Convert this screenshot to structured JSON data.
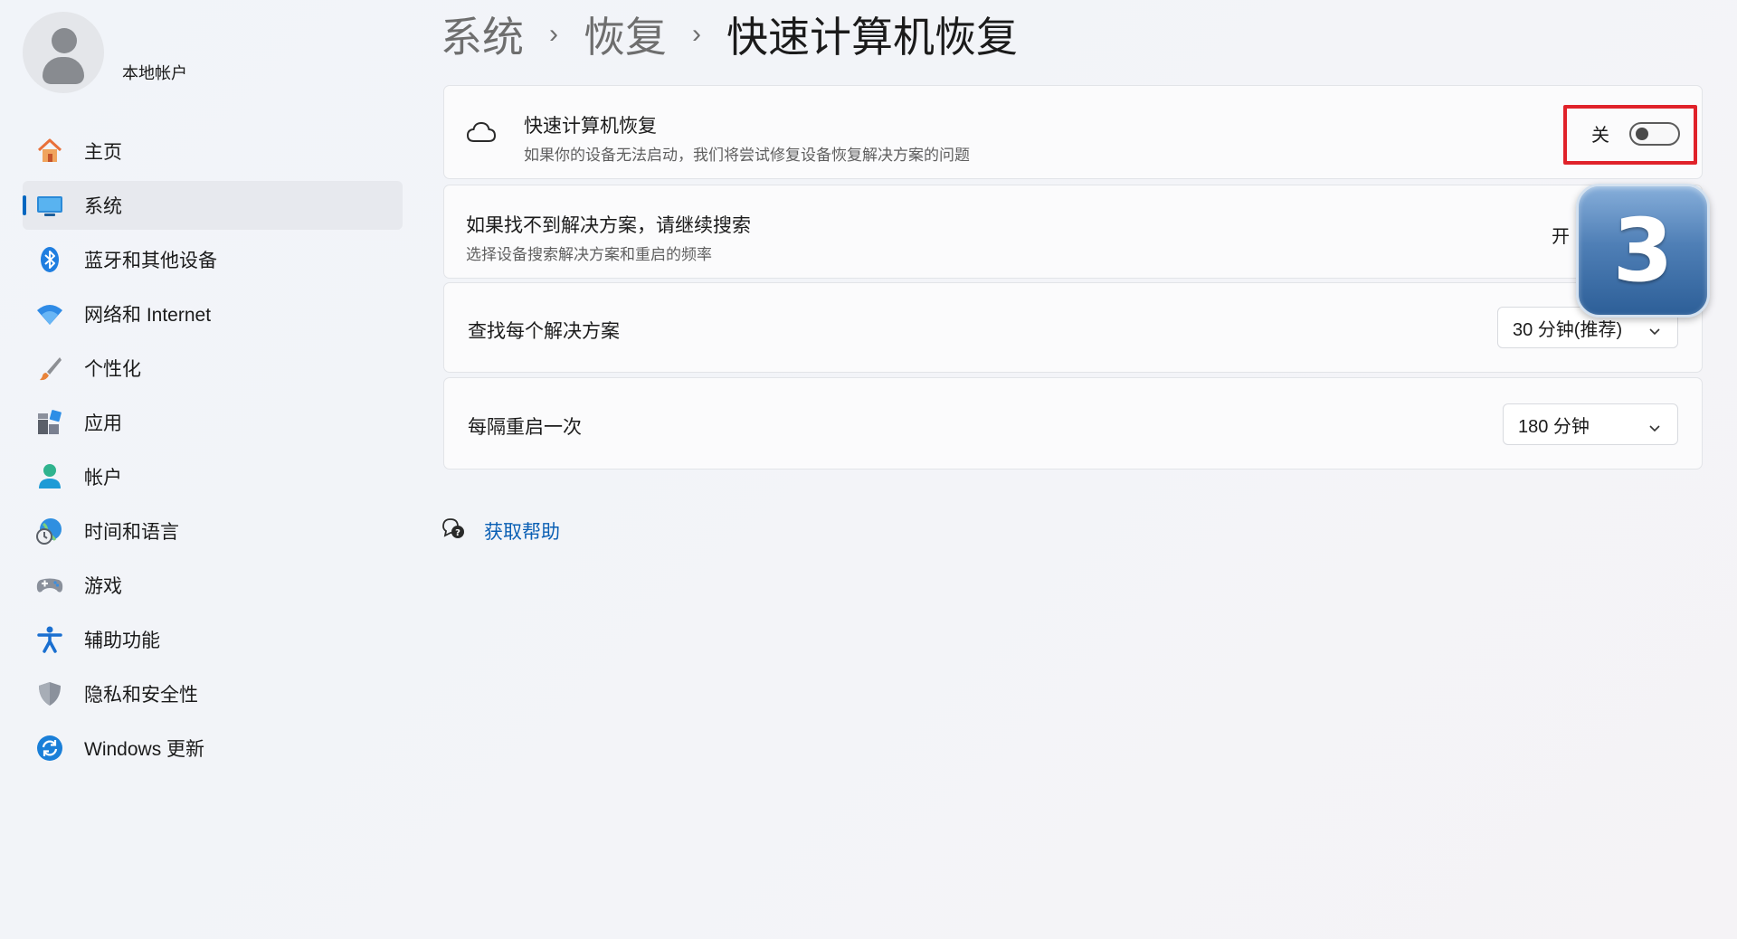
{
  "account": {
    "name": "本地帐户"
  },
  "sidebar": {
    "items": [
      {
        "label": "主页",
        "icon": "home-icon"
      },
      {
        "label": "系统",
        "icon": "monitor-icon",
        "selected": true
      },
      {
        "label": "蓝牙和其他设备",
        "icon": "bluetooth-icon"
      },
      {
        "label": "网络和 Internet",
        "icon": "wifi-icon"
      },
      {
        "label": "个性化",
        "icon": "brush-icon"
      },
      {
        "label": "应用",
        "icon": "apps-icon"
      },
      {
        "label": "帐户",
        "icon": "person-icon"
      },
      {
        "label": "时间和语言",
        "icon": "globe-clock-icon"
      },
      {
        "label": "游戏",
        "icon": "gamepad-icon"
      },
      {
        "label": "辅助功能",
        "icon": "accessibility-icon"
      },
      {
        "label": "隐私和安全性",
        "icon": "shield-icon"
      },
      {
        "label": "Windows 更新",
        "icon": "update-icon"
      }
    ]
  },
  "breadcrumb": {
    "part1": "系统",
    "part2": "恢复",
    "current": "快速计算机恢复",
    "separator": "›"
  },
  "settings": {
    "quick_recovery": {
      "title": "快速计算机恢复",
      "subtitle": "如果你的设备无法启动，我们将尝试修复设备恢复解决方案的问题",
      "state_label": "关",
      "enabled": false,
      "icon": "cloud-icon"
    },
    "continue_search": {
      "title": "如果找不到解决方案，请继续搜索",
      "subtitle": "选择设备搜索解决方案和重启的频率",
      "state_label": "开"
    },
    "search_each": {
      "title": "查找每个解决方案",
      "value": "30 分钟(推荐)"
    },
    "restart_every": {
      "title": "每隔重启一次",
      "value": "180 分钟"
    }
  },
  "help": {
    "label": "获取帮助",
    "icon": "help-chat-icon"
  },
  "annotation": {
    "step_number": "3",
    "highlight_color": "#e0222a"
  },
  "colors": {
    "accent": "#0067c0",
    "link": "#0a5fb4"
  }
}
